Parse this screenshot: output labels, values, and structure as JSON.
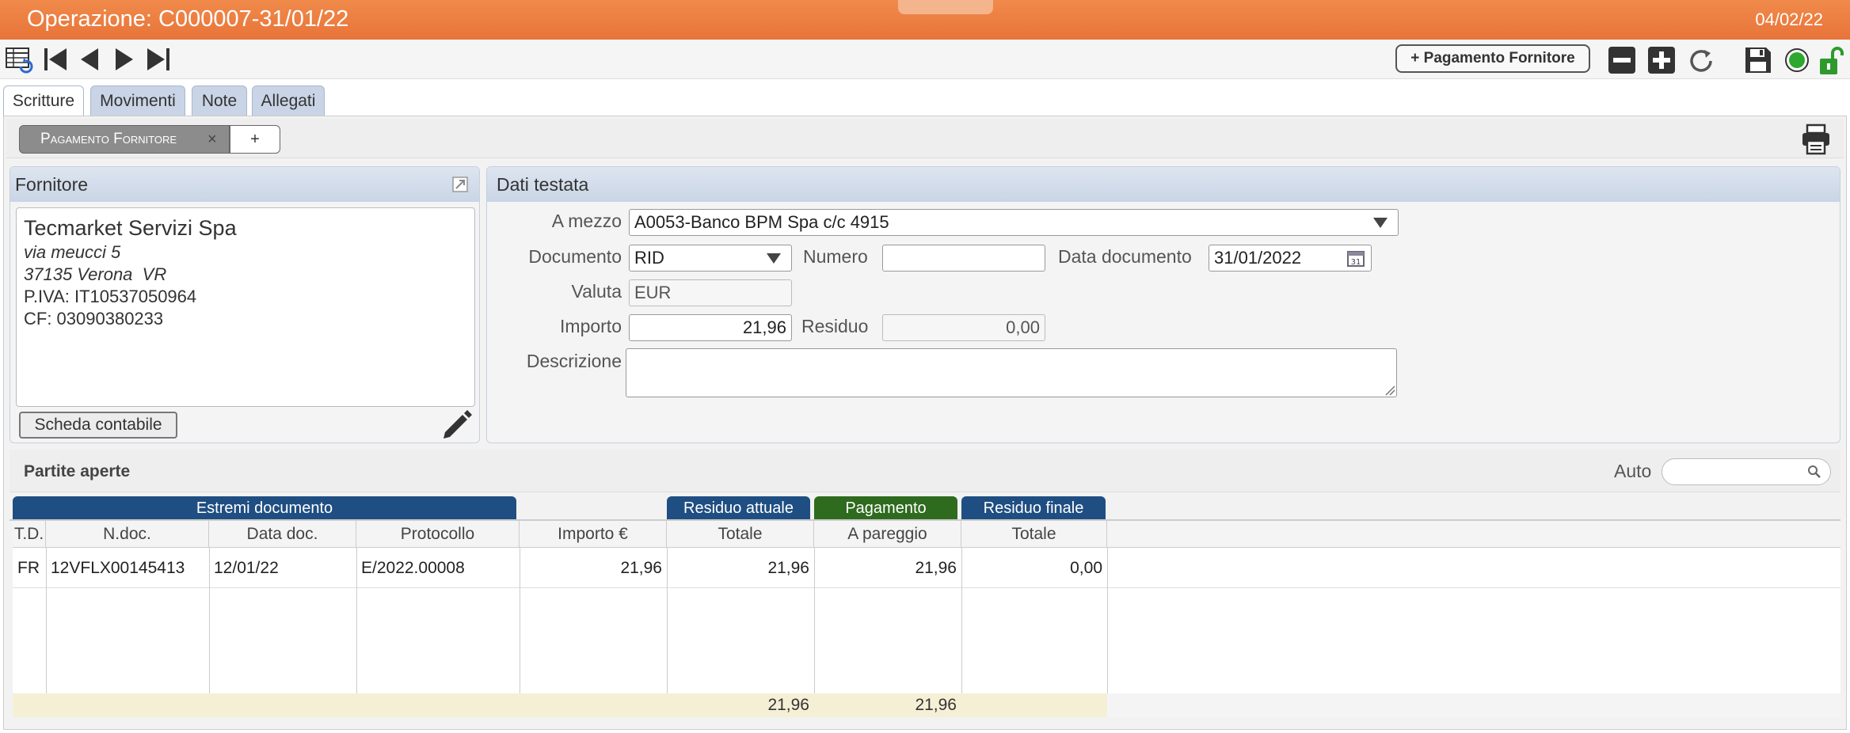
{
  "titlebar": {
    "title": "Operazione: C000007-31/01/22",
    "date": "04/02/22",
    "bg_color": "#e8743a"
  },
  "toolbar": {
    "add_payment_button": "+ Pagamento Fornitore"
  },
  "tabs": [
    {
      "label": "Scritture",
      "active": true
    },
    {
      "label": "Movimenti",
      "active": false
    },
    {
      "label": "Note",
      "active": false
    },
    {
      "label": "Allegati",
      "active": false
    }
  ],
  "subtab": {
    "label": "Pagamento Fornitore",
    "close": "×",
    "add": "+"
  },
  "supplier": {
    "title": "Fornitore",
    "name": "Tecmarket Servizi Spa",
    "street": "via meucci 5",
    "city": "37135 Verona  VR",
    "vat": "P.IVA: IT10537050964",
    "cf": "CF: 03090380233",
    "ledger_button": "Scheda contabile"
  },
  "header": {
    "title": "Dati testata",
    "a_mezzo_label": "A mezzo",
    "a_mezzo_value": "A0053-Banco BPM Spa c/c 4915",
    "documento_label": "Documento",
    "documento_value": "RID",
    "numero_label": "Numero",
    "numero_value": "",
    "data_doc_label": "Data documento",
    "data_doc_value": "31/01/2022",
    "valuta_label": "Valuta",
    "valuta_value": "EUR",
    "importo_label": "Importo",
    "importo_value": "21,96",
    "residuo_label": "Residuo",
    "residuo_value": "0,00",
    "descrizione_label": "Descrizione",
    "descrizione_value": ""
  },
  "partite": {
    "title": "Partite aperte",
    "auto_label": "Auto",
    "groups": {
      "estremi": {
        "label": "Estremi documento",
        "color": "#1f4e82"
      },
      "residuo_attuale": {
        "label": "Residuo attuale",
        "color": "#1f4e82"
      },
      "pagamento": {
        "label": "Pagamento",
        "color": "#2e6b1e"
      },
      "residuo_finale": {
        "label": "Residuo finale",
        "color": "#1f4e82"
      }
    },
    "columns": [
      "T.D.",
      "N.doc.",
      "Data doc.",
      "Protocollo",
      "Importo €",
      "Totale",
      "A pareggio",
      "Totale"
    ],
    "rows": [
      {
        "td": "FR",
        "ndoc": "12VFLX00145413",
        "data": "12/01/22",
        "protocollo": "E/2022.00008",
        "importo": "21,96",
        "residuo_totale": "21,96",
        "a_pareggio": "21,96",
        "residuo_finale": "0,00"
      }
    ],
    "totals": {
      "residuo_totale": "21,96",
      "a_pareggio": "21,96"
    }
  }
}
